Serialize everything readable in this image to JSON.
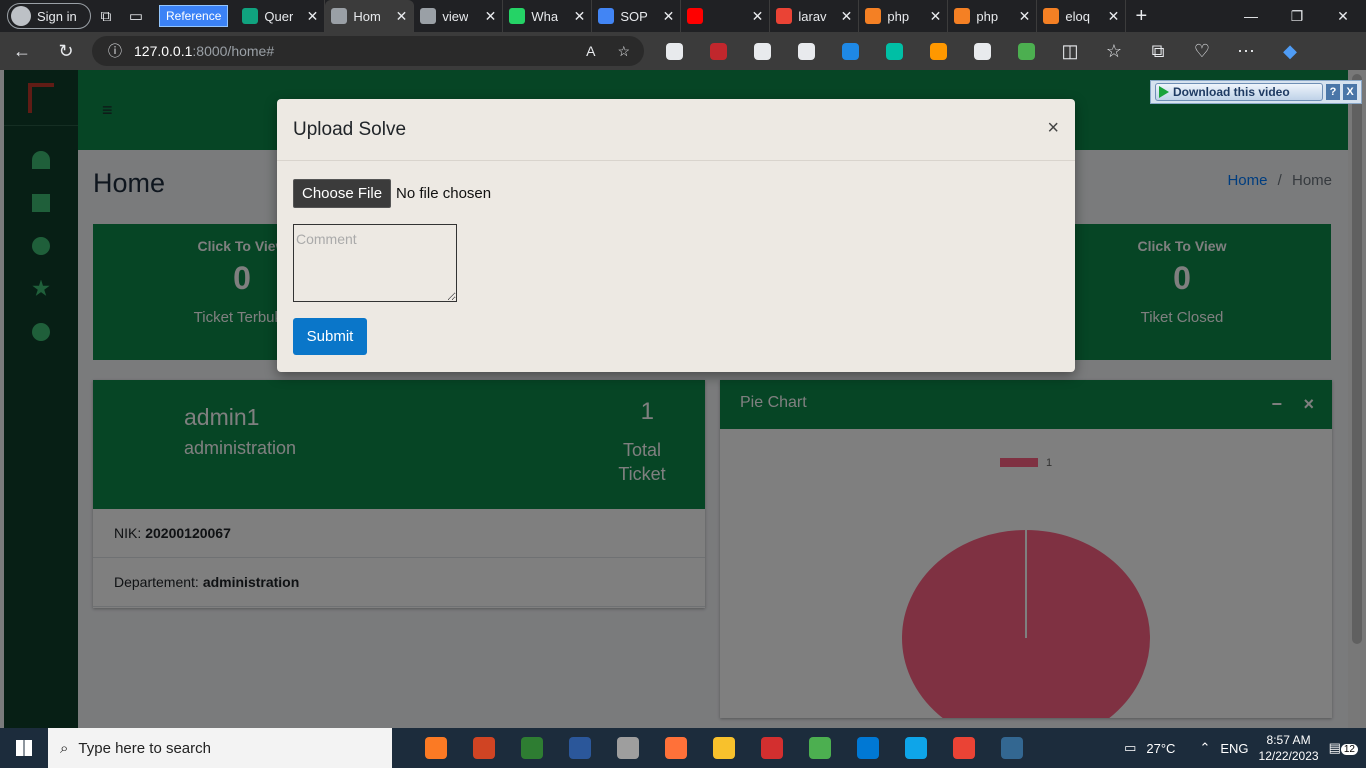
{
  "browser": {
    "sign_in": "Sign in",
    "tabs": [
      {
        "label": "Reference",
        "kind": "extension-button"
      },
      {
        "label": "Quer",
        "favicon": "openai-icon",
        "color": "#10a37f"
      },
      {
        "label": "Hom",
        "favicon": "page-icon",
        "color": "#9aa0a6",
        "active": true
      },
      {
        "label": "view",
        "favicon": "page-icon",
        "color": "#9aa0a6"
      },
      {
        "label": "Wha",
        "favicon": "whatsapp-icon",
        "color": "#25d366"
      },
      {
        "label": "SOP",
        "favicon": "docs-icon",
        "color": "#4285f4"
      },
      {
        "label": "",
        "favicon": "youtube-icon",
        "color": "#ff0000"
      },
      {
        "label": "larav",
        "favicon": "google-icon",
        "color": "#ea4335"
      },
      {
        "label": "php",
        "favicon": "stackoverflow-icon",
        "color": "#f48024"
      },
      {
        "label": "php",
        "favicon": "stackoverflow-icon",
        "color": "#f48024"
      },
      {
        "label": "eloq",
        "favicon": "stackoverflow-icon",
        "color": "#f48024"
      }
    ],
    "url_host": "127.0.0.1",
    "url_path": ":8000/home#",
    "extension_colors": [
      "#e8eaed",
      "#c1272d",
      "#e8eaed",
      "#e8eaed",
      "#1e88e5",
      "#00bfa5",
      "#ff9800",
      "#e8eaed",
      "#4caf50"
    ]
  },
  "page": {
    "title": "Home",
    "breadcrumb": {
      "home": "Home",
      "separator": "/",
      "current": "Home"
    },
    "boxes": [
      {
        "cta": "Click To View",
        "count": "0",
        "label": "Ticket Terbuka"
      },
      {
        "cta": "Click To View",
        "count": "0",
        "label": "Tiket Closed"
      }
    ],
    "profile": {
      "name": "admin1",
      "department": "administration",
      "total_count": "1",
      "total_label": "Total Ticket",
      "nik_label": "NIK:",
      "nik_value": "20200120067",
      "dept_label": "Departement:",
      "dept_value": "administration"
    },
    "pie_card": {
      "title": "Pie Chart",
      "minimize": "−",
      "close": "×"
    }
  },
  "chart_data": {
    "type": "pie",
    "categories": [
      "1"
    ],
    "values": [
      1
    ],
    "colors": [
      "#ff6384"
    ],
    "legend": "top"
  },
  "modal": {
    "title": "Upload Solve",
    "close": "×",
    "choose_file": "Choose File",
    "no_file": "No file chosen",
    "comment_placeholder": "Comment",
    "submit": "Submit"
  },
  "download_widget": {
    "label": "Download this video",
    "help": "?",
    "close": "X"
  },
  "taskbar": {
    "search_placeholder": "Type here to search",
    "apps": [
      {
        "name": "xampp-icon",
        "color": "#fb7a24"
      },
      {
        "name": "powerpoint-icon",
        "color": "#d04423"
      },
      {
        "name": "sheets-icon",
        "color": "#2e7d32"
      },
      {
        "name": "word-icon",
        "color": "#2b579a"
      },
      {
        "name": "photos-icon",
        "color": "#9e9e9e"
      },
      {
        "name": "firefox-icon",
        "color": "#ff7139"
      },
      {
        "name": "file-explorer-icon",
        "color": "#f8c12c"
      },
      {
        "name": "acrobat-icon",
        "color": "#d32f2f"
      },
      {
        "name": "chrome-icon",
        "color": "#4caf50"
      },
      {
        "name": "vscode-icon",
        "color": "#0078d4"
      },
      {
        "name": "edge-icon",
        "color": "#0ea5e9"
      },
      {
        "name": "chrome-profile-icon",
        "color": "#ea4335"
      },
      {
        "name": "postgresql-icon",
        "color": "#336791"
      }
    ],
    "weather": "27°C",
    "language": "ENG",
    "time": "8:57 AM",
    "date": "12/22/2023",
    "notifications": "12"
  }
}
